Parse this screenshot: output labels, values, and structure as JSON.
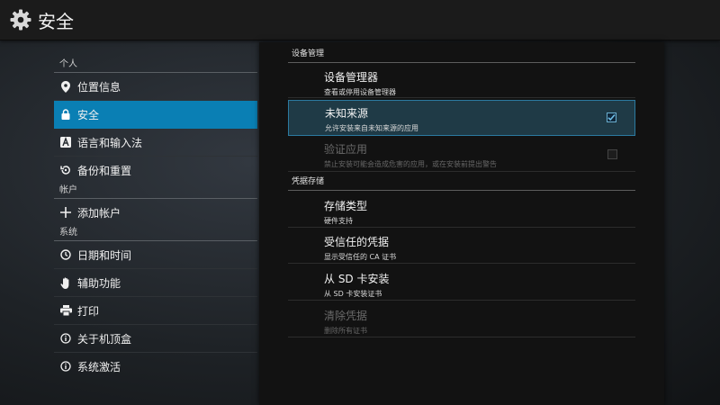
{
  "window": {
    "title": "安全",
    "icon": "settings-gear-icon"
  },
  "sidebar": {
    "categories": [
      {
        "label": "个人",
        "items": [
          {
            "label": "位置信息",
            "icon": "location-pin-icon"
          },
          {
            "label": "安全",
            "icon": "lock-icon",
            "selected": true
          },
          {
            "label": "语言和输入法",
            "icon": "keyboard-letter-icon"
          },
          {
            "label": "备份和重置",
            "icon": "backup-restore-icon"
          }
        ]
      },
      {
        "label": "帐户",
        "items": [
          {
            "label": "添加帐户",
            "icon": "plus-icon"
          }
        ]
      },
      {
        "label": "系统",
        "items": [
          {
            "label": "日期和时间",
            "icon": "clock-icon"
          },
          {
            "label": "辅助功能",
            "icon": "hand-icon"
          },
          {
            "label": "打印",
            "icon": "printer-icon"
          },
          {
            "label": "关于机顶盒",
            "icon": "info-icon"
          },
          {
            "label": "系统激活",
            "icon": "info-icon"
          }
        ]
      }
    ]
  },
  "detail": {
    "sections": [
      {
        "label": "设备管理",
        "items": [
          {
            "title": "设备管理器",
            "summary": "查看或停用设备管理器"
          },
          {
            "title": "未知来源",
            "summary": "允许安装来自未知来源的应用",
            "checkbox": true,
            "checked": true,
            "focused": true
          },
          {
            "title": "验证应用",
            "summary": "禁止安装可能会造成危害的应用，或在安装前提出警告",
            "checkbox": true,
            "checked": false,
            "disabled": true
          }
        ]
      },
      {
        "label": "凭据存储",
        "items": [
          {
            "title": "存储类型",
            "summary": "硬件支持"
          },
          {
            "title": "受信任的凭据",
            "summary": "显示受信任的 CA 证书"
          },
          {
            "title": "从 SD 卡安装",
            "summary": "从 SD 卡安装证书"
          },
          {
            "title": "清除凭据",
            "summary": "删除所有证书",
            "disabled": true
          }
        ]
      }
    ]
  },
  "colors": {
    "accent": "#0a7fb4",
    "focus_border": "#2b7aa0",
    "panel_bg": "#121212",
    "topbar_bg": "#1b1b1b"
  }
}
